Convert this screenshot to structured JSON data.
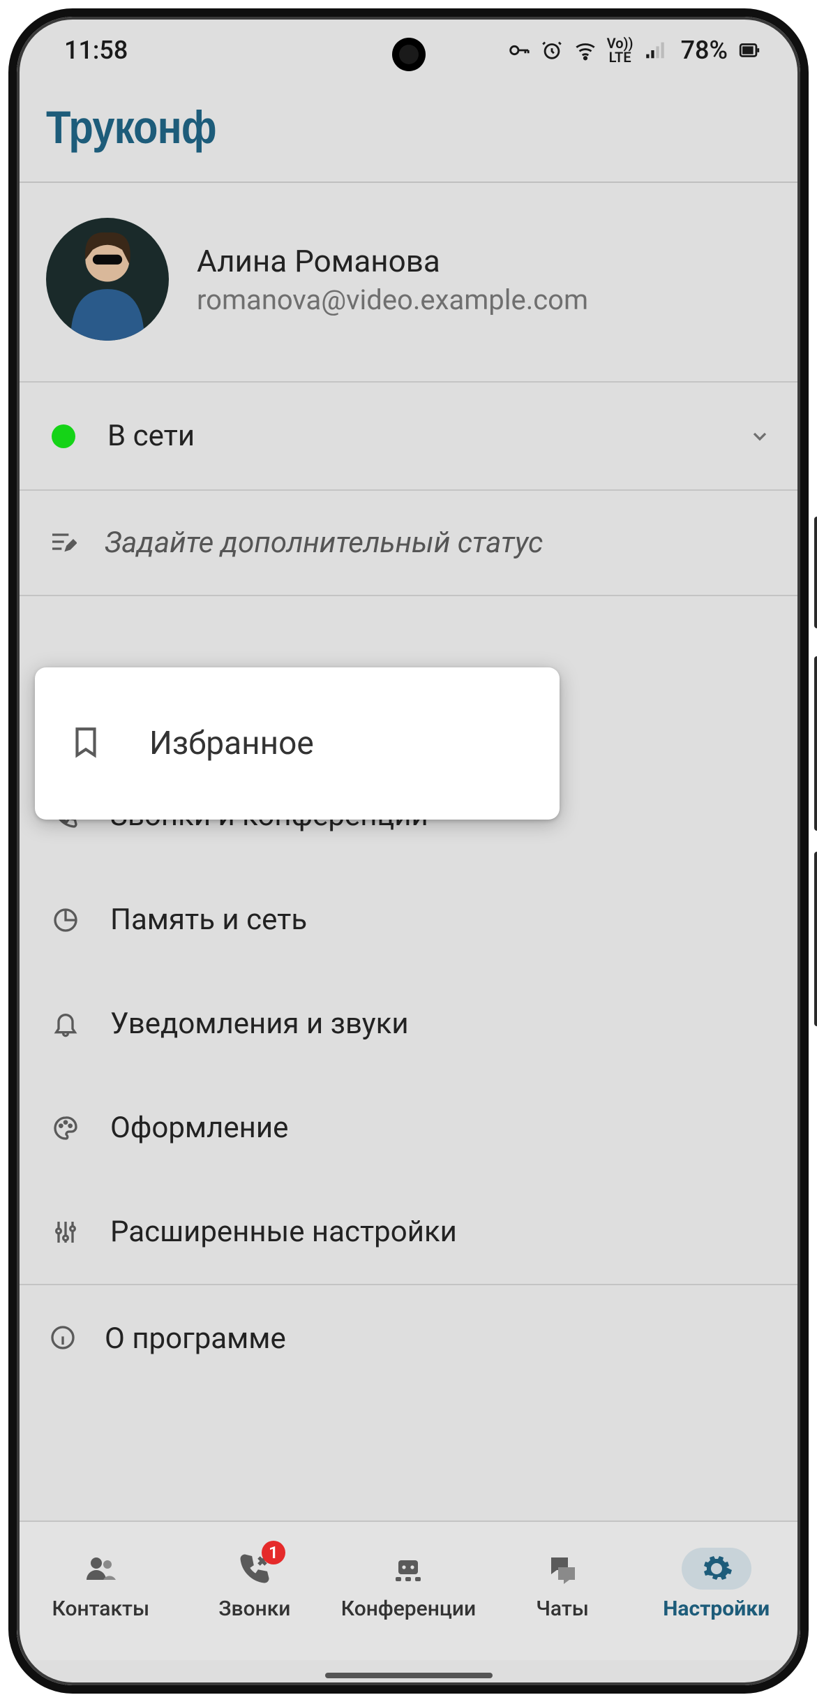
{
  "statusbar": {
    "time": "11:58",
    "battery": "78%"
  },
  "app": {
    "title": "Труконф"
  },
  "profile": {
    "name": "Алина Романова",
    "email": "romanova@video.example.com"
  },
  "presence": {
    "status": "В сети",
    "extra_placeholder": "Задайте дополнительный статус"
  },
  "featured": {
    "label": "Избранное"
  },
  "settings": {
    "calls": "Звонки и конференции",
    "memory": "Память и сеть",
    "notifications": "Уведомления и звуки",
    "appearance": "Оформление",
    "advanced": "Расширенные настройки"
  },
  "about": {
    "label": "О программе"
  },
  "nav": {
    "contacts": "Контакты",
    "calls": "Звонки",
    "conferences": "Конференции",
    "chats": "Чаты",
    "settings": "Настройки",
    "calls_badge": "1"
  }
}
